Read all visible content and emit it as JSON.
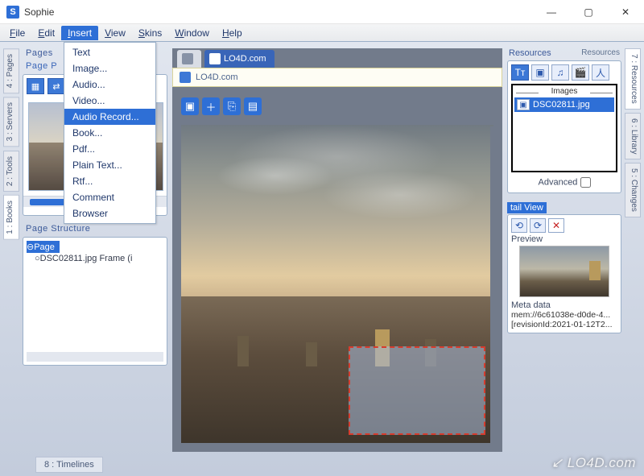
{
  "title": "Sophie",
  "menubar": [
    "File",
    "Edit",
    "Insert",
    "View",
    "Skins",
    "Window",
    "Help"
  ],
  "open_menu_index": 2,
  "insert_menu": {
    "items": [
      "Text",
      "Image...",
      "Audio...",
      "Video...",
      "Audio Record...",
      "Book...",
      "Pdf...",
      "Plain Text...",
      "Rtf...",
      "Comment",
      "Browser"
    ],
    "highlight_index": 4
  },
  "left_side_tabs": [
    "4 : Pages",
    "3 : Servers",
    "2 : Tools",
    "1 : Books"
  ],
  "right_side_tabs": [
    "7 : Resources",
    "6 : Library",
    "5 : Changes"
  ],
  "bottom_tab": "8 : Timelines",
  "pages_panel": {
    "title": "Pages",
    "subtitle": "Page P"
  },
  "page_structure": {
    "title": "Page Structure",
    "root": "Page",
    "child": "DSC02811.jpg Frame (i"
  },
  "center": {
    "doc_tab": "LO4D.com",
    "subbar": "LO4D.com"
  },
  "resources": {
    "header_top": "Resources",
    "header": "Resources",
    "group": "Images",
    "item": "DSC02811.jpg",
    "advanced": "Advanced"
  },
  "detail": {
    "title": "tail View",
    "preview": "Preview",
    "meta_label": "Meta data",
    "meta1": "mem://6c61038e-d0de-4...",
    "meta2": "[revisionId:2021-01-12T2..."
  },
  "watermark": "↙ LO4D.com"
}
